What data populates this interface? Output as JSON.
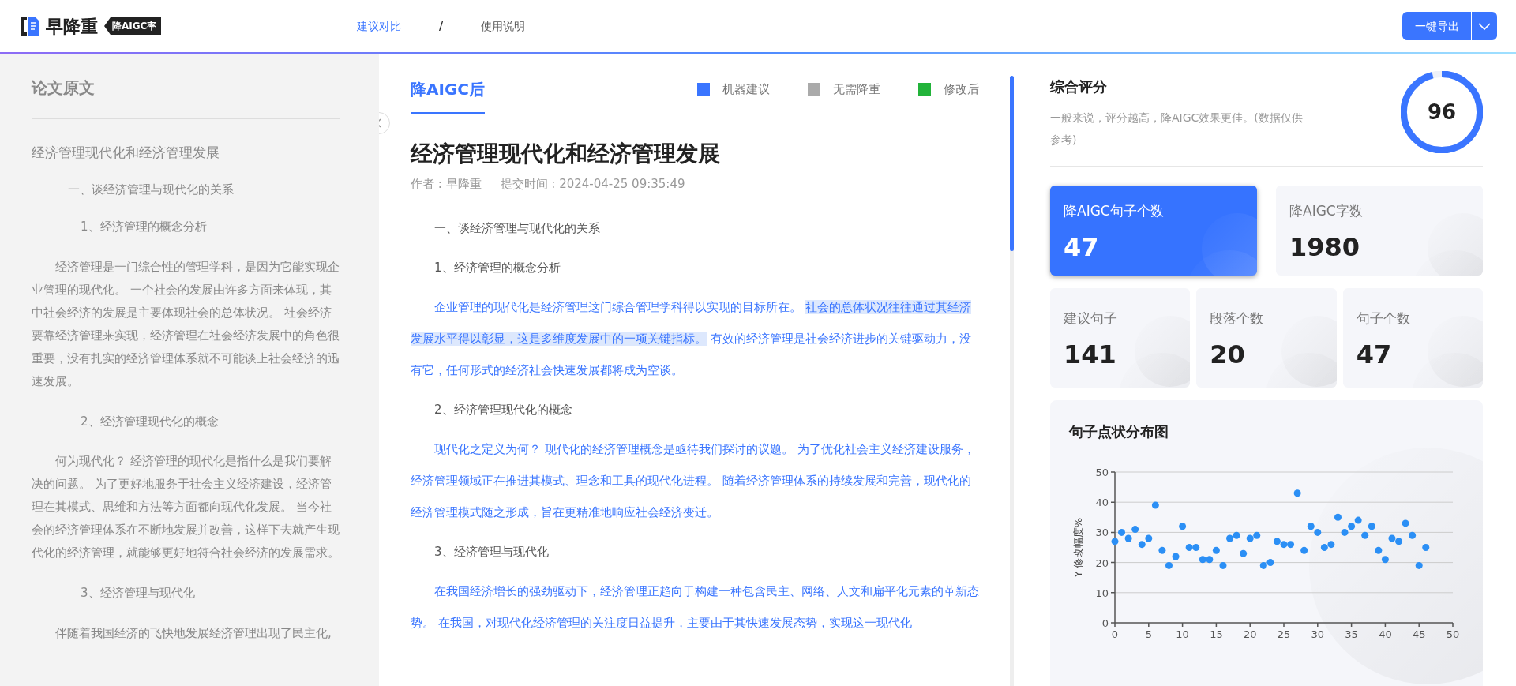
{
  "header": {
    "logo_text": "早降重",
    "logo_tag": "降AIGC率",
    "nav": [
      {
        "label": "建议对比",
        "selected": true
      },
      {
        "label": "使用说明",
        "selected": false
      }
    ],
    "nav_separator": "/",
    "export_button": "一键导出"
  },
  "original": {
    "heading": "论文原文",
    "title": "经济管理现代化和经济管理发展",
    "blocks": [
      {
        "kind": "heading1",
        "text": "一、谈经济管理与现代化的关系"
      },
      {
        "kind": "heading2",
        "text": "1、经济管理的概念分析"
      },
      {
        "kind": "para",
        "text": "经济管理是一门综合性的管理学科，是因为它能实现企业管理的现代化。 一个社会的发展由许多方面来体现，其中社会经济的发展是主要体现社会的总体状况。 社会经济要靠经济管理来实现，经济管理在社会经济发展中的角色很重要，没有扎实的经济管理体系就不可能谈上社会经济的迅速发展。"
      },
      {
        "kind": "heading2",
        "text": "2、经济管理现代化的概念"
      },
      {
        "kind": "para",
        "text": "何为现代化？ 经济管理的现代化是指什么是我们要解决的问题。 为了更好地服务于社会主义经济建设，经济管理在其模式、思维和方法等方面都向现代化发展。 当今社会的经济管理体系在不断地发展并改善，这样下去就产生现代化的经济管理，就能够更好地符合社会经济的发展需求。"
      },
      {
        "kind": "heading2",
        "text": "3、经济管理与现代化"
      },
      {
        "kind": "para",
        "text": "伴随着我国经济的飞快地发展经济管理出现了民主化,"
      }
    ]
  },
  "result": {
    "tab": "降AIGC后",
    "legend": [
      {
        "label": "机器建议",
        "color": "#3a75ff"
      },
      {
        "label": "无需降重",
        "color": "#aaaaaa"
      },
      {
        "label": "修改后",
        "color": "#22b33a"
      }
    ],
    "title": "经济管理现代化和经济管理发展",
    "author": "作者 : 早降重",
    "submitted": "提交时间 : 2024-04-25 09:35:49",
    "blocks": [
      {
        "kind": "heading",
        "segments": [
          {
            "text": "一、谈经济管理与现代化的关系",
            "highlighted": false
          }
        ]
      },
      {
        "kind": "heading",
        "segments": [
          {
            "text": "1、经济管理的概念分析",
            "highlighted": false
          }
        ]
      },
      {
        "kind": "suggestion",
        "segments": [
          {
            "text": "企业管理的现代化是经济管理这门综合管理学科得以实现的目标所在。 ",
            "highlighted": false
          },
          {
            "text": "社会的总体状况往往通过其经济发展水平得以彰显，这是多维度发展中的一项关键指标。",
            "highlighted": true
          },
          {
            "text": " 有效的经济管理是社会经济进步的关键驱动力，没有它，任何形式的经济社会快速发展都将成为空谈。",
            "highlighted": false
          }
        ]
      },
      {
        "kind": "heading",
        "segments": [
          {
            "text": "2、经济管理现代化的概念",
            "highlighted": false
          }
        ]
      },
      {
        "kind": "suggestion",
        "segments": [
          {
            "text": "现代化之定义为何？ 现代化的经济管理概念是亟待我们探讨的议题。 为了优化社会主义经济建设服务，经济管理领域正在推进其模式、理念和工具的现代化进程。 随着经济管理体系的持续发展和完善，现代化的经济管理模式随之形成，旨在更精准地响应社会经济变迁。",
            "highlighted": false
          }
        ]
      },
      {
        "kind": "heading",
        "segments": [
          {
            "text": "3、经济管理与现代化",
            "highlighted": false
          }
        ]
      },
      {
        "kind": "suggestion",
        "segments": [
          {
            "text": "在我国经济增长的强劲驱动下，经济管理正趋向于构建一种包含民主、网络、人文和扁平化元素的革新态势。 在我国，对现代化经济管理的关注度日益提升，主要由于其快速发展态势，实现这一现代化",
            "highlighted": false
          }
        ]
      }
    ]
  },
  "score": {
    "title": "综合评分",
    "note": "一般来说，评分越高，降AIGC效果更佳。(数据仅供参考)",
    "value": "96",
    "level": 0.96
  },
  "summary_cards": [
    {
      "label": "降AIGC句子个数",
      "value": "47",
      "selected": true
    },
    {
      "label": "降AIGC字数",
      "value": "1980",
      "selected": false
    }
  ],
  "count_cards": [
    {
      "label": "建议句子",
      "value": "141",
      "selected": false
    },
    {
      "label": "段落个数",
      "value": "20",
      "selected": false
    },
    {
      "label": "句子个数",
      "value": "47",
      "selected": false
    }
  ],
  "chart": {
    "title": "句子点状分布图",
    "chart_data": {
      "type": "scatter",
      "grid": true,
      "ylabel": "Y-修改幅度%",
      "xlim": [
        0,
        50
      ],
      "ylim": [
        0,
        50
      ],
      "xticks": [
        0,
        5,
        10,
        15,
        20,
        25,
        30,
        35,
        40,
        45,
        50
      ],
      "yticks": [
        0,
        10,
        20,
        30,
        40,
        50
      ],
      "series": [
        {
          "color": "#2b8ff5",
          "x": [
            0,
            1,
            2,
            3,
            4,
            5,
            6,
            7,
            8,
            9,
            10,
            11,
            12,
            13,
            14,
            15,
            16,
            17,
            18,
            19,
            20,
            21,
            22,
            23,
            24,
            25,
            26,
            27,
            28,
            29,
            30,
            31,
            32,
            33,
            34,
            35,
            36,
            37,
            38,
            39,
            40,
            41,
            42,
            43,
            44,
            45,
            46
          ],
          "values": [
            27,
            30,
            28,
            31,
            26,
            28,
            39,
            24,
            19,
            22,
            32,
            25,
            25,
            21,
            21,
            24,
            19,
            28,
            29,
            23,
            28,
            29,
            19,
            20,
            27,
            26,
            26,
            43,
            24,
            32,
            30,
            25,
            26,
            35,
            30,
            32,
            34,
            29,
            32,
            24,
            21,
            28,
            27,
            33,
            29,
            19,
            25
          ]
        }
      ]
    }
  }
}
